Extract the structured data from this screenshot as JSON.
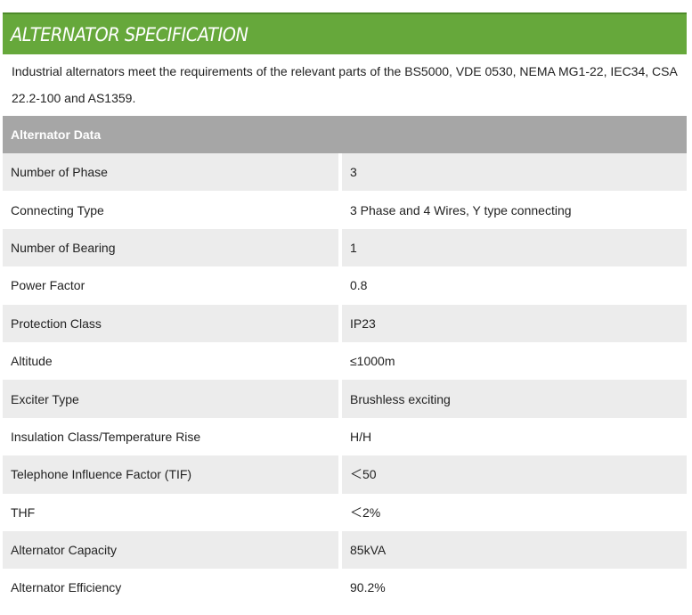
{
  "title": "ALTERNATOR SPECIFICATION",
  "intro": "Industrial alternators meet the requirements of the relevant parts of the BS5000, VDE 0530, NEMA MG1-22, IEC34, CSA 22.2-100 and AS1359.",
  "section": "Alternator Data",
  "rows": [
    {
      "label": "Number of Phase",
      "value": "3"
    },
    {
      "label": "Connecting Type",
      "value": "3 Phase and 4 Wires, Y type connecting"
    },
    {
      "label": "Number of Bearing",
      "value": "1"
    },
    {
      "label": "Power Factor",
      "value": "0.8"
    },
    {
      "label": "Protection Class",
      "value": "IP23"
    },
    {
      "label": "Altitude",
      "value": "≤1000m"
    },
    {
      "label": "Exciter Type",
      "value": "Brushless exciting"
    },
    {
      "label": "Insulation Class/Temperature Rise",
      "value": "H/H"
    },
    {
      "label": "Telephone Influence Factor (TIF)",
      "value": "＜50"
    },
    {
      "label": "THF",
      "value": "＜2%"
    },
    {
      "label": "Alternator Capacity",
      "value": "85kVA"
    },
    {
      "label": "Alternator Efficiency",
      "value": "90.2%"
    }
  ],
  "colors": {
    "title_bg": "#66a83b",
    "section_bg": "#a6a6a6",
    "row_shade": "#ececec"
  }
}
